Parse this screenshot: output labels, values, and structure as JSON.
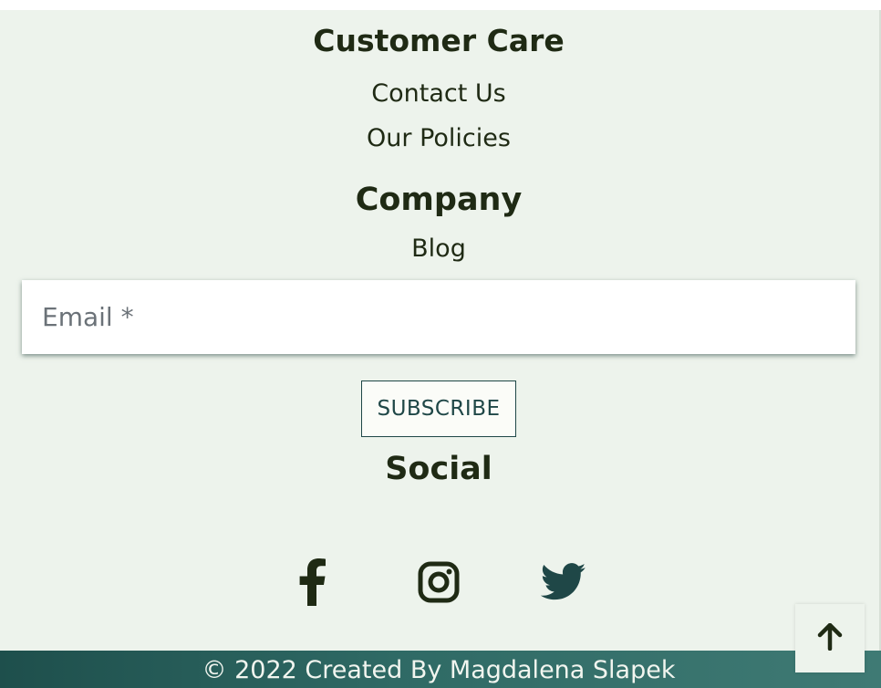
{
  "customer_care": {
    "heading": "Customer Care",
    "links": [
      "Contact Us",
      "Our Policies"
    ]
  },
  "company": {
    "heading": "Company",
    "links": [
      "Blog"
    ]
  },
  "newsletter": {
    "email_placeholder": "Email *",
    "email_value": "",
    "subscribe_label": "SUBSCRIBE"
  },
  "social": {
    "heading": "Social",
    "icons": [
      "facebook-icon",
      "instagram-icon",
      "twitter-icon"
    ]
  },
  "footer": {
    "copyright": "© 2022 Created By Magdalena Slapek"
  },
  "back_to_top": {
    "icon": "arrow-up-icon"
  },
  "colors": {
    "panel_background": "#edf3ec",
    "text_dark": "#1f2a14",
    "accent_teal": "#1f4747",
    "copyright_bar": "#2f6a65"
  }
}
